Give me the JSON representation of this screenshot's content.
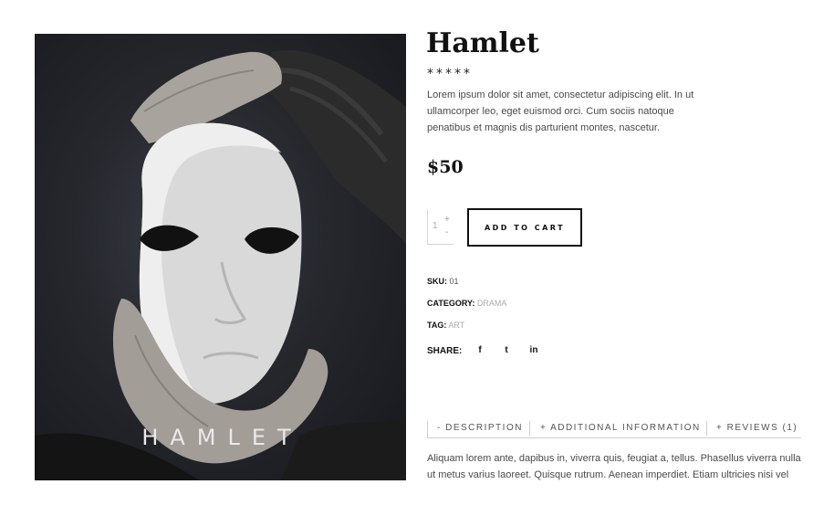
{
  "product": {
    "title": "Hamlet",
    "rating_stars": "*****",
    "short_description": "Lorem ipsum dolor sit amet, consectetur adipiscing elit. In ut ullamcorper leo, eget euismod orci. Cum sociis natoque penatibus et magnis dis parturient montes, nascetur.",
    "price": "$50",
    "image_title": "HAMLET"
  },
  "cart": {
    "quantity": "1",
    "plus_label": "+",
    "minus_label": "-",
    "add_to_cart_label": "ADD TO CART"
  },
  "meta": {
    "sku_label": "SKU:",
    "sku_value": "01",
    "category_label": "CATEGORY:",
    "category_value": "DRAMA",
    "tag_label": "TAG:",
    "tag_value": "ART",
    "share_label": "SHARE:",
    "social_icons": [
      "facebook-icon",
      "twitter-icon",
      "linkedin-icon"
    ],
    "social_glyphs": [
      "f",
      "t",
      "in"
    ]
  },
  "tabs": [
    {
      "label": "-  DESCRIPTION",
      "active": true
    },
    {
      "label": "+  ADDITIONAL INFORMATION",
      "active": false
    },
    {
      "label": "+  REVIEWS (1)",
      "active": false
    }
  ],
  "tab_content": {
    "text": "Aliquam lorem ante, dapibus in, viverra quis, feugiat a, tellus. Phasellus viverra nulla ut metus varius laoreet. Quisque rutrum. Aenean imperdiet. Etiam ultricies nisi vel"
  },
  "colors": {
    "text": "#111111",
    "muted": "#999999",
    "border": "#cfcfcf",
    "button_border": "#111111"
  }
}
